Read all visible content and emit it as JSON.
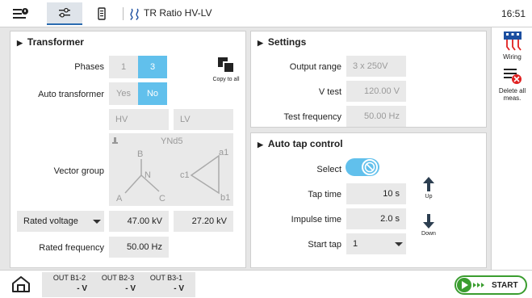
{
  "topbar": {
    "title": "TR Ratio HV-LV",
    "clock": "16:51",
    "icons": [
      "menu-overview-icon",
      "settings-sliders-icon",
      "device-icon",
      "ratio-icon"
    ]
  },
  "transformer": {
    "title": "Transformer",
    "phases_label": "Phases",
    "phases_options": [
      "1",
      "3"
    ],
    "phases_selected": "3",
    "auto_label": "Auto transformer",
    "auto_options": [
      "Yes",
      "No"
    ],
    "auto_selected": "No",
    "copy_to_all": "Copy to all",
    "hv_placeholder": "HV",
    "lv_placeholder": "LV",
    "vector_group_label": "Vector group",
    "vector_group_value": "YNd5",
    "diagram_labels": {
      "b": "B",
      "n": "N",
      "a": "A",
      "c": "C",
      "a1": "a1",
      "c1": "c1",
      "b1": "b1"
    },
    "rated_voltage_label": "Rated voltage",
    "rated_voltage_hv": "47.00 kV",
    "rated_voltage_lv": "27.20 kV",
    "rated_frequency_label": "Rated frequency",
    "rated_frequency_value": "50.00 Hz"
  },
  "settings": {
    "title": "Settings",
    "output_range_label": "Output range",
    "output_range_value": "3 x 250V",
    "v_test_label": "V test",
    "v_test_value": "120.00 V",
    "test_frequency_label": "Test frequency",
    "test_frequency_value": "50.00 Hz"
  },
  "auto_tap": {
    "title": "Auto tap control",
    "select_label": "Select",
    "tap_time_label": "Tap time",
    "tap_time_value": "10 s",
    "impulse_time_label": "Impulse time",
    "impulse_time_value": "2.0 s",
    "start_tap_label": "Start tap",
    "start_tap_value": "1",
    "up_label": "Up",
    "down_label": "Down"
  },
  "tools": {
    "wiring_label": "Wiring",
    "delete_label_1": "Delete all",
    "delete_label_2": "meas."
  },
  "bottombar": {
    "outputs": [
      {
        "name": "OUT B1-2",
        "value": "- V"
      },
      {
        "name": "OUT B2-3",
        "value": "- V"
      },
      {
        "name": "OUT B3-1",
        "value": "- V"
      }
    ],
    "start_label": "START"
  },
  "colors": {
    "accent": "#61c0ec",
    "start_green": "#3a9d2f",
    "delete_red": "#e02020",
    "wiring_blue": "#1c4fa0"
  }
}
